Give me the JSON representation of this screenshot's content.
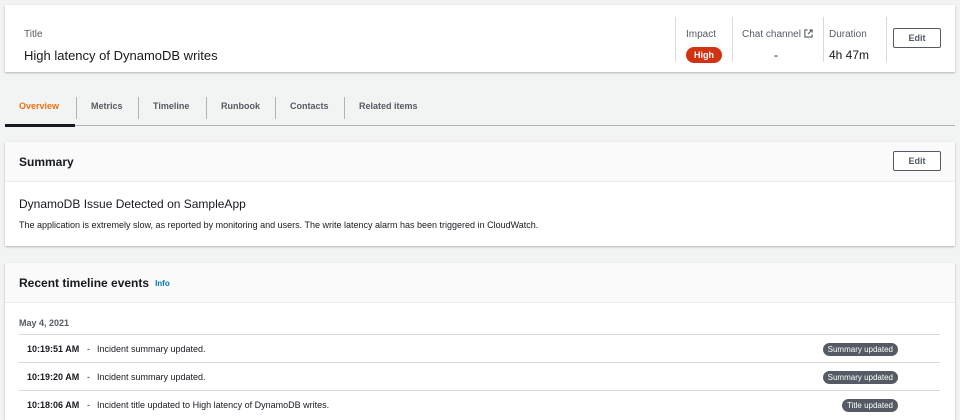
{
  "header": {
    "title_label": "Title",
    "title": "High latency of DynamoDB writes",
    "impact_label": "Impact",
    "impact_value": "High",
    "chat_label": "Chat channel",
    "chat_value": "-",
    "duration_label": "Duration",
    "duration_value": "4h 47m",
    "edit_label": "Edit"
  },
  "tabs": [
    {
      "label": "Overview",
      "active": true
    },
    {
      "label": "Metrics"
    },
    {
      "label": "Timeline"
    },
    {
      "label": "Runbook"
    },
    {
      "label": "Contacts"
    },
    {
      "label": "Related items"
    }
  ],
  "summary": {
    "title": "Summary",
    "edit_label": "Edit",
    "heading": "DynamoDB Issue Detected on SampleApp",
    "text": "The application is extremely slow, as reported by monitoring and users. The write latency alarm has been triggered in CloudWatch."
  },
  "timeline": {
    "title": "Recent timeline events",
    "info_label": "Info",
    "date": "May 4, 2021",
    "events": [
      {
        "time": "10:19:51 AM",
        "sep": "-",
        "message": "Incident summary updated.",
        "badge": "Summary updated"
      },
      {
        "time": "10:19:20 AM",
        "sep": "-",
        "message": "Incident summary updated.",
        "badge": "Summary updated"
      },
      {
        "time": "10:18:06 AM",
        "sep": "-",
        "message": "Incident title updated to High latency of DynamoDB writes.",
        "badge": "Title updated"
      }
    ]
  },
  "colors": {
    "accent": "#ec7211",
    "impact_high": "#d13212",
    "link": "#0073bb",
    "badge": "#545b64"
  },
  "icons": {
    "chat_external": "external-link-icon"
  }
}
